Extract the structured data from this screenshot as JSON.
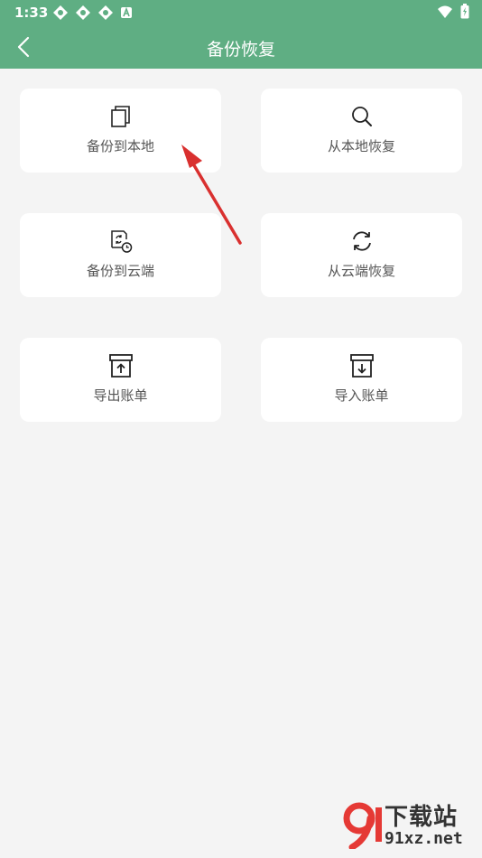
{
  "status_bar": {
    "time": "1:33"
  },
  "app_bar": {
    "title": "备份恢复"
  },
  "cards": [
    {
      "label": "备份到本地",
      "icon": "copy-icon"
    },
    {
      "label": "从本地恢复",
      "icon": "search-icon"
    },
    {
      "label": "备份到云端",
      "icon": "cloud-backup-icon"
    },
    {
      "label": "从云端恢复",
      "icon": "sync-icon"
    },
    {
      "label": "导出账单",
      "icon": "export-box-icon"
    },
    {
      "label": "导入账单",
      "icon": "import-box-icon"
    }
  ],
  "watermark": {
    "title": "下载站",
    "domain": "91xz.net"
  },
  "colors": {
    "primary": "#5fae83",
    "background": "#f4f4f4",
    "card": "#ffffff",
    "annotation_arrow": "#d9302f"
  }
}
